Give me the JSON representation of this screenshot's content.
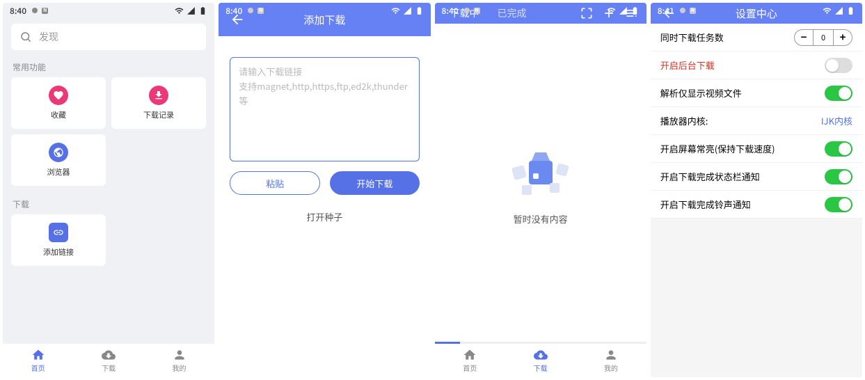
{
  "status": {
    "time1": "8:40",
    "time2": "8:40",
    "time3": "8:40",
    "time4": "8:41"
  },
  "screen1": {
    "search_placeholder": "发现",
    "section_common": "常用功能",
    "tiles": {
      "favorites": "收藏",
      "download_history": "下载记录",
      "browser": "浏览器"
    },
    "section_download": "下载",
    "add_link": "添加链接",
    "nav": {
      "home": "首页",
      "download": "下载",
      "mine": "我的"
    }
  },
  "screen2": {
    "title": "添加下载",
    "placeholder_line1": "请输入下载链接",
    "placeholder_line2": "支持magnet,http,https,ftp,ed2k,thunder等",
    "paste": "粘贴",
    "start": "开始下载",
    "open_seed": "打开种子"
  },
  "screen3": {
    "tab_downloading": "下载中",
    "tab_done": "已完成",
    "empty": "暂时没有内容",
    "nav": {
      "home": "首页",
      "download": "下载",
      "mine": "我的"
    }
  },
  "screen4": {
    "title": "设置中心",
    "rows": {
      "concurrent": "同时下载任务数",
      "concurrent_val": "0",
      "background": "开启后台下载",
      "parse_video": "解析仅显示视频文件",
      "player_core": "播放器内核:",
      "player_core_val": "IJK内核",
      "keep_screen": "开启屏幕常亮(保持下载速度)",
      "notify_status": "开启下载完成状态栏通知",
      "notify_sound": "开启下载完成铃声通知"
    }
  }
}
